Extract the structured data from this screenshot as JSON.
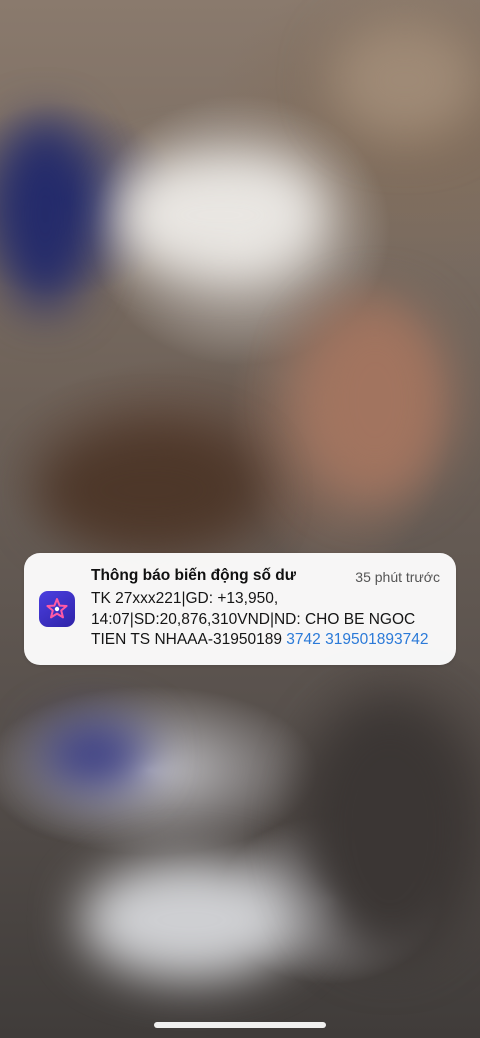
{
  "notification": {
    "title": "Thông báo biến động số dư",
    "time": "35 phút trước",
    "body_line1": "TK 27xxx221|GD: +13,950,",
    "body_line2": "14:07|SD:20,876,310VND|ND: CHO BE NGOC",
    "body_line3_text": "TIEN TS NHAAA-31950189",
    "body_line3_links": "3742 319501893742",
    "app_icon": "star-app-icon"
  },
  "colors": {
    "link": "#2b7ad8",
    "app_icon": "#3f33c8"
  }
}
